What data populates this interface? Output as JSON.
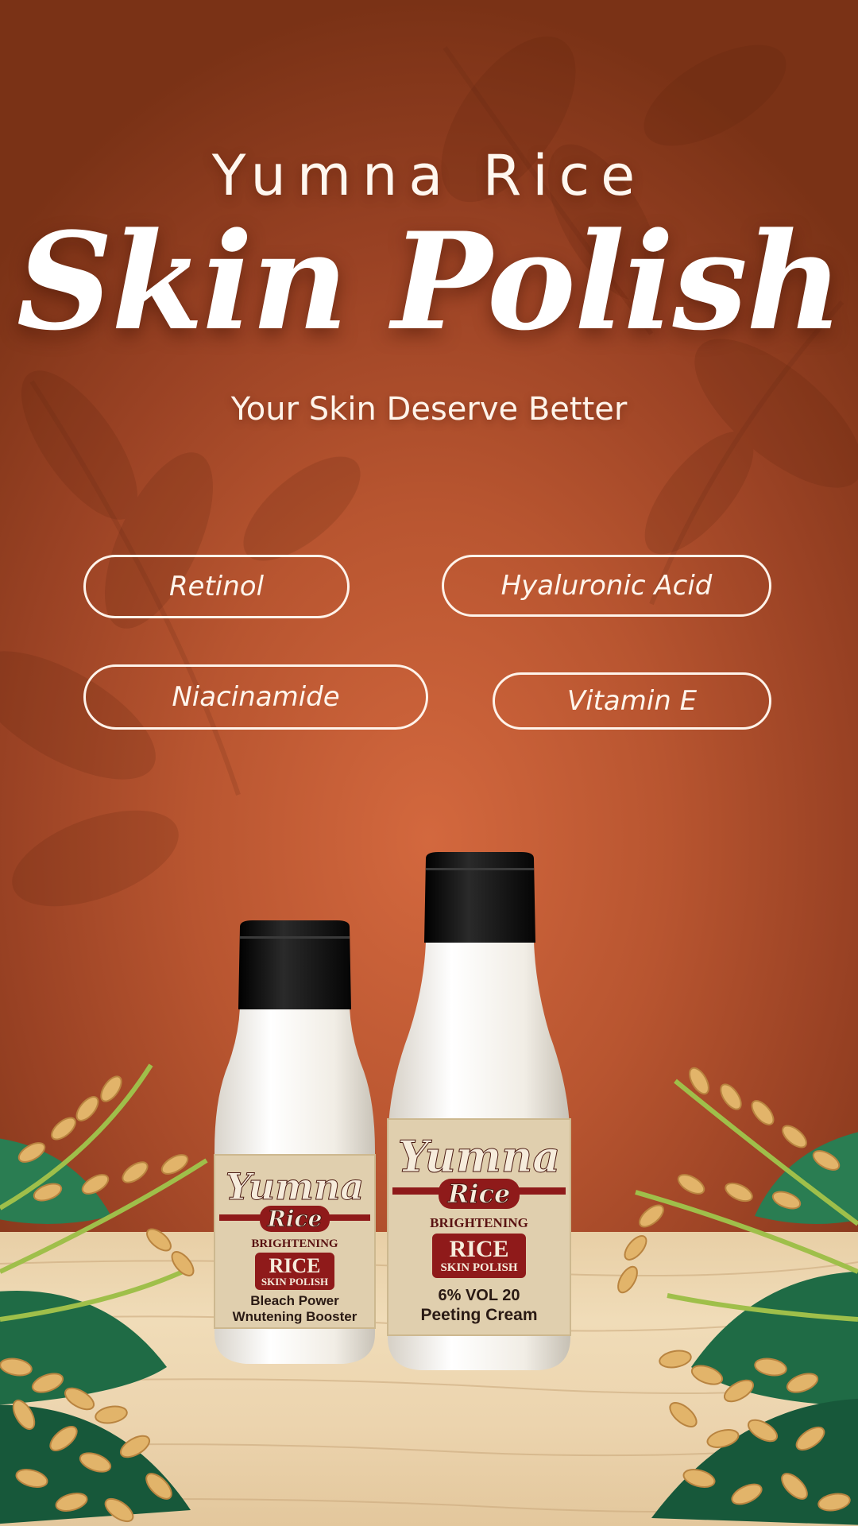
{
  "header": {
    "brand": "Yumna Rice",
    "title": "Skin Polish",
    "tagline": "Your Skin Deserve Better"
  },
  "ingredients": [
    {
      "label": "Retinol"
    },
    {
      "label": "Hyaluronic Acid"
    },
    {
      "label": "Niacinamide"
    },
    {
      "label": "Vitamin E"
    }
  ],
  "products": [
    {
      "brand_script": "Yumna",
      "brand_sub": "Rice",
      "line": "BRIGHTENING",
      "badge_main": "RICE",
      "badge_sub": "SKIN POLISH",
      "desc_line1": "Bleach Power",
      "desc_line2": "Wnutening Booster"
    },
    {
      "brand_script": "Yumna",
      "brand_sub": "Rice",
      "line": "BRIGHTENING",
      "badge_main": "RICE",
      "badge_sub": "SKIN POLISH",
      "desc_line1": "6% VOL 20",
      "desc_line2": "Peeting Cream"
    }
  ],
  "colors": {
    "background": "#c25a32",
    "text": "#ffffff",
    "label_red": "#8f1a1a",
    "cap": "#111111",
    "bottle": "#f4f1ea",
    "leaf": "#1f6b45",
    "grain": "#e2b46a"
  }
}
